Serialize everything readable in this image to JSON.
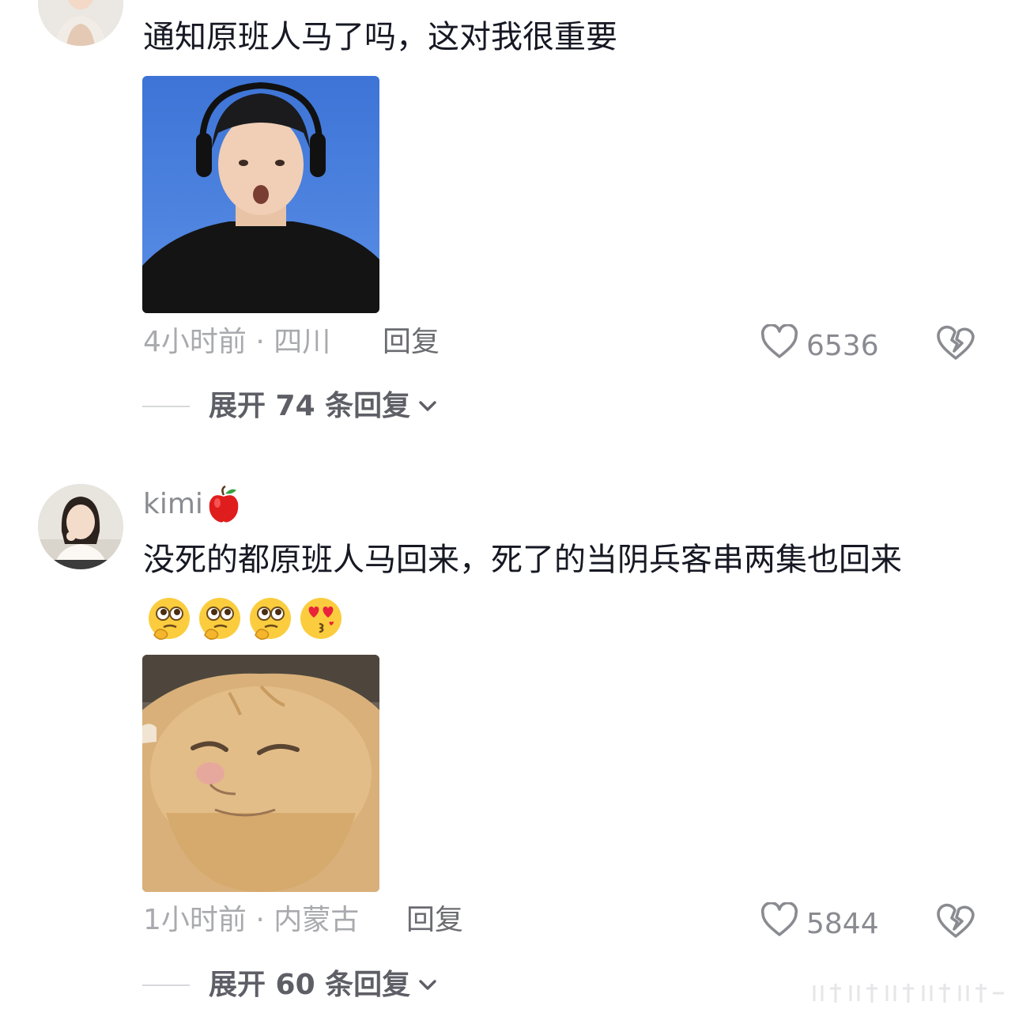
{
  "comments": [
    {
      "username": "",
      "text": "通知原班人马了吗，这对我很重要",
      "meta": "4小时前 · 四川",
      "reply_label": "回复",
      "likes": "6536",
      "expand_label": "展开 74 条回复",
      "sticker": "person-headphones-sticker"
    },
    {
      "username": "kimi",
      "username_emoji": "apple-emoji",
      "text": "没死的都原班人马回来，死了的当阴兵客串两集也回来",
      "emojis": [
        "thinking-face-emoji",
        "thinking-face-emoji",
        "thinking-face-emoji",
        "heart-eyes-kiss-emoji"
      ],
      "meta": "1小时前 · 内蒙古",
      "reply_label": "回复",
      "likes": "5844",
      "expand_label": "展开 60 条回复",
      "sticker": "cat-smug-sticker"
    }
  ],
  "colors": {
    "text_primary": "#161823",
    "text_secondary": "#a9aaae",
    "icon_gray": "#8a8b91",
    "background": "#ffffff"
  }
}
